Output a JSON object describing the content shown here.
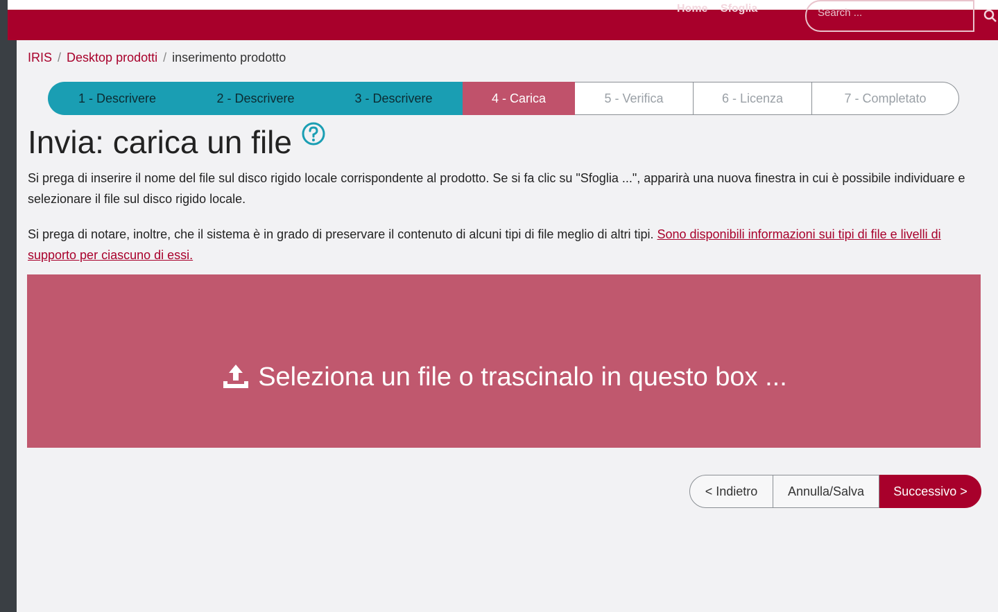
{
  "header": {
    "nav": [
      "Home",
      "Sfoglia"
    ],
    "search_placeholder": "Search ...",
    "search_icon": "search-icon"
  },
  "breadcrumb": {
    "items": [
      "IRIS",
      "Desktop prodotti",
      "inserimento prodotto"
    ],
    "separator": "/"
  },
  "steps": [
    {
      "label": "1 - Descrivere",
      "status": "done"
    },
    {
      "label": "2 - Descrivere",
      "status": "done"
    },
    {
      "label": "3 - Descrivere",
      "status": "done"
    },
    {
      "label": "4 - Carica",
      "status": "current"
    },
    {
      "label": "5 - Verifica",
      "status": "todo"
    },
    {
      "label": "6 - Licenza",
      "status": "todo"
    },
    {
      "label": "7 - Completato",
      "status": "todo"
    }
  ],
  "page": {
    "title": "Invia: carica un file",
    "help_icon": "question-circle-icon",
    "paragraph1": "Si prega di inserire il nome del file sul disco rigido locale corrispondente al prodotto. Se si fa clic su \"Sfoglia ...\", apparirà una nuova finestra in cui è possibile individuare e selezionare il file sul disco rigido locale.",
    "paragraph2_text": "Si prega di notare, inoltre, che il sistema è in grado di preservare il contenuto di alcuni tipi di file meglio di altri tipi.",
    "paragraph2_link": "Sono disponibili informazioni sui tipi di file e livelli di supporto per ciascuno di essi."
  },
  "dropzone": {
    "label": "Seleziona un file o trascinalo in questo box ...",
    "icon": "upload-icon"
  },
  "buttons": {
    "back": "< Indietro",
    "cancel": "Annulla/Salva",
    "next": "Successivo >"
  },
  "colors": {
    "brand": "#a8002b",
    "step_done": "#1a9eb3",
    "step_current": "#c0526b",
    "dropzone": "#c0586e"
  }
}
